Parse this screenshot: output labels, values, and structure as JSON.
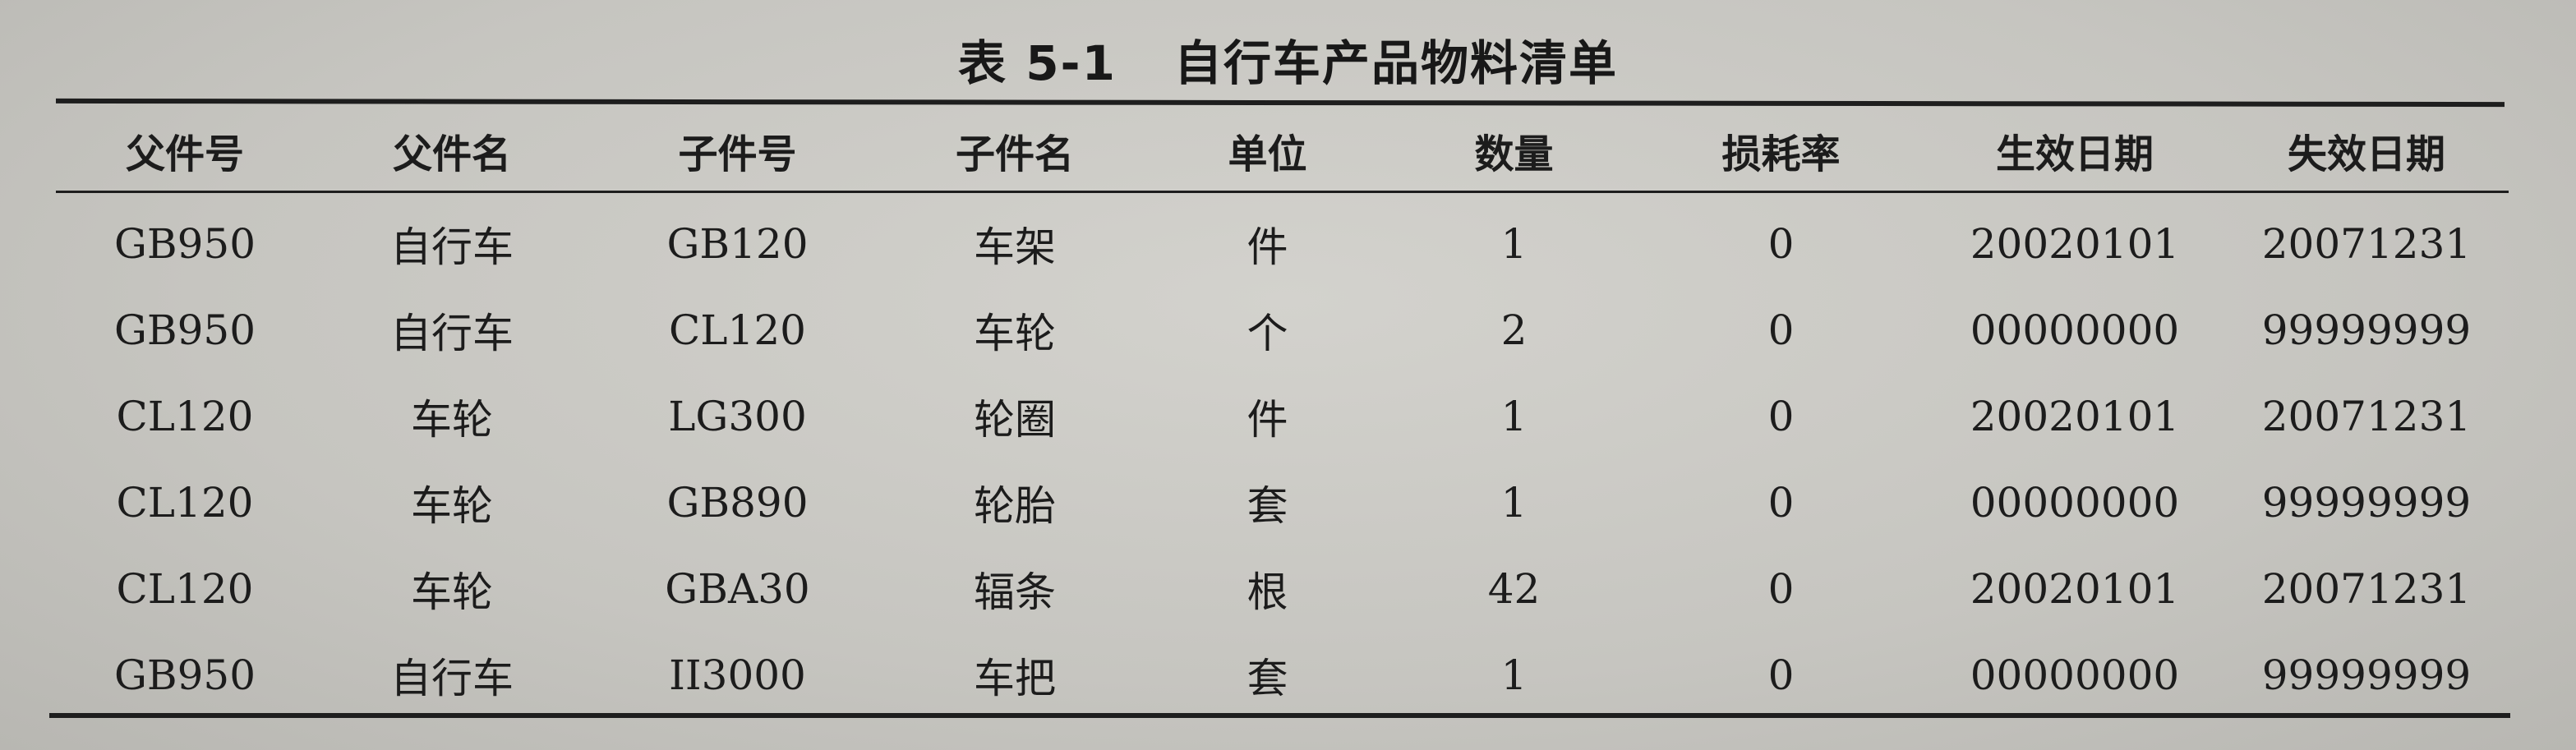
{
  "caption": {
    "label": "表 5-1",
    "title": "自行车产品物料清单"
  },
  "table": {
    "headers": [
      "父件号",
      "父件名",
      "子件号",
      "子件名",
      "单位",
      "数量",
      "损耗率",
      "生效日期",
      "失效日期"
    ],
    "rows": [
      [
        "GB950",
        "自行车",
        "GB120",
        "车架",
        "件",
        "1",
        "0",
        "20020101",
        "20071231"
      ],
      [
        "GB950",
        "自行车",
        "CL120",
        "车轮",
        "个",
        "2",
        "0",
        "00000000",
        "99999999"
      ],
      [
        "CL120",
        "车轮",
        "LG300",
        "轮圈",
        "件",
        "1",
        "0",
        "20020101",
        "20071231"
      ],
      [
        "CL120",
        "车轮",
        "GB890",
        "轮胎",
        "套",
        "1",
        "0",
        "00000000",
        "99999999"
      ],
      [
        "CL120",
        "车轮",
        "GBA30",
        "辐条",
        "根",
        "42",
        "0",
        "20020101",
        "20071231"
      ],
      [
        "GB950",
        "自行车",
        "II3000",
        "车把",
        "套",
        "1",
        "0",
        "00000000",
        "99999999"
      ]
    ]
  }
}
